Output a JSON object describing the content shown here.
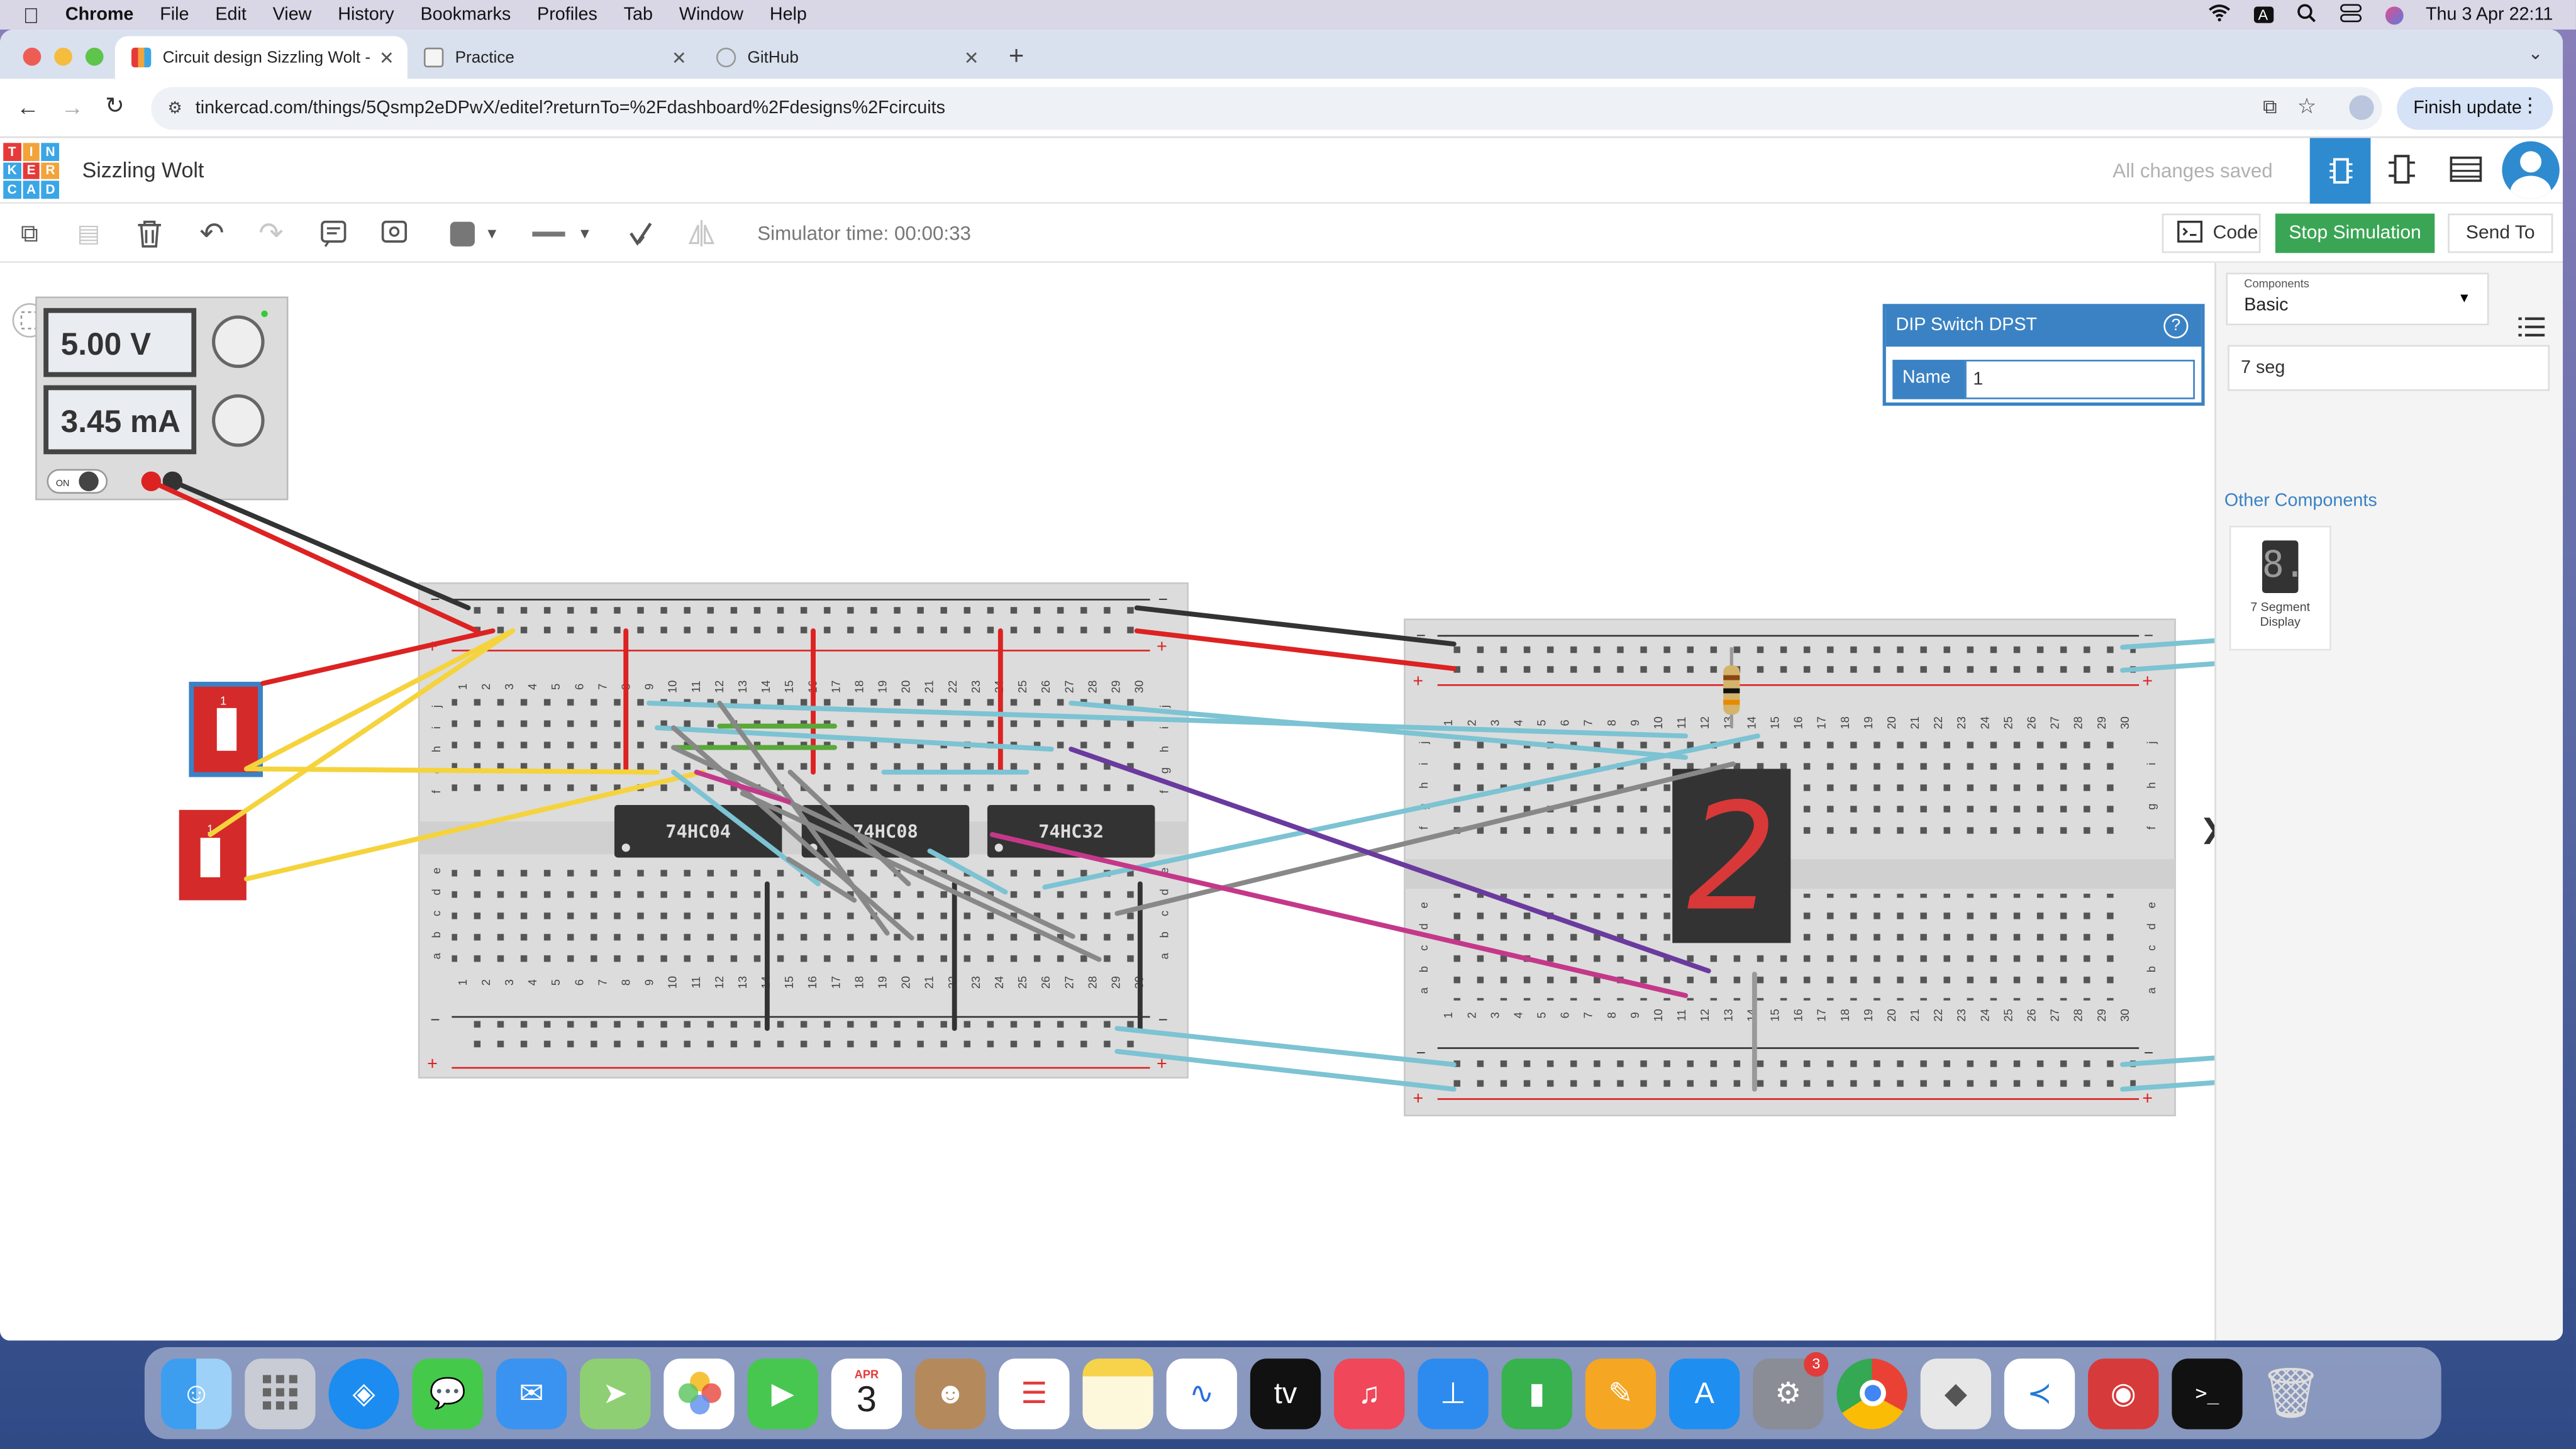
{
  "menubar": {
    "app": "Chrome",
    "items": [
      "File",
      "Edit",
      "View",
      "History",
      "Bookmarks",
      "Profiles",
      "Tab",
      "Window",
      "Help"
    ],
    "clock": "Thu 3 Apr  22:11",
    "input_indicator": "A"
  },
  "tabs": [
    {
      "title": "Circuit design Sizzling Wolt -",
      "active": true
    },
    {
      "title": "Practice",
      "active": false
    },
    {
      "title": "GitHub",
      "active": false
    }
  ],
  "address": {
    "url": "tinkercad.com/things/5Qsmp2eDPwX/editel?returnTo=%2Fdashboard%2Fdesigns%2Fcircuits",
    "finish_update": "Finish update"
  },
  "tinkercad": {
    "logo": [
      "T",
      "I",
      "N",
      "K",
      "E",
      "R",
      "C",
      "A",
      "D"
    ],
    "project_name": "Sizzling Wolt",
    "save_status": "All changes saved"
  },
  "toolbar": {
    "simulator_time": "Simulator time: 00:00:33",
    "code": "Code",
    "stop": "Stop Simulation",
    "send": "Send To"
  },
  "power_supply": {
    "voltage": "5.00 V",
    "current": "3.45 mA",
    "on_label": "ON"
  },
  "switches": [
    {
      "label": "1"
    },
    {
      "label": "1"
    }
  ],
  "chips": [
    "74HC04",
    "74HC08",
    "74HC32"
  ],
  "breadboard": {
    "numbers": [
      "1",
      "2",
      "3",
      "4",
      "5",
      "6",
      "7",
      "8",
      "9",
      "10",
      "11",
      "12",
      "13",
      "14",
      "15",
      "16",
      "17",
      "18",
      "19",
      "20",
      "21",
      "22",
      "23",
      "24",
      "25",
      "26",
      "27",
      "28",
      "29",
      "30"
    ],
    "rows_top": [
      "j",
      "i",
      "h",
      "g",
      "f"
    ],
    "rows_bottom": [
      "e",
      "d",
      "c",
      "b",
      "a"
    ],
    "minus": "−",
    "plus": "+"
  },
  "seven_segment_digit": "2",
  "inspector": {
    "title": "DIP Switch DPST",
    "help": "?",
    "name_label": "Name",
    "name_value": "1"
  },
  "panel": {
    "components_label": "Components",
    "components_value": "Basic",
    "search_value": "7 seg",
    "other_title": "Other Components",
    "result_name": "7 Segment Display",
    "result_glyph": "8."
  },
  "dock": {
    "calendar_month": "APR",
    "calendar_day": "3",
    "settings_badge": "3",
    "apps": [
      "finder",
      "launchpad",
      "safari",
      "messages",
      "mail",
      "maps",
      "photos",
      "facetime",
      "calendar",
      "contacts",
      "reminders",
      "notes",
      "freeform",
      "tv",
      "music",
      "keynote",
      "numbers",
      "pages",
      "app-store",
      "system-settings",
      "chrome",
      "roblox",
      "vscode",
      "photo-booth",
      "terminal",
      "trash"
    ]
  }
}
